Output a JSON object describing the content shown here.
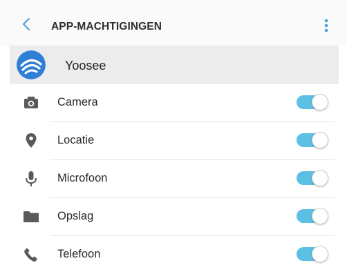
{
  "header": {
    "title": "APP-MACHTIGINGEN",
    "back_icon": "chevron-left-icon",
    "more_icon": "more-vertical-icon"
  },
  "app": {
    "name": "Yoosee",
    "icon": "yoosee-app-icon"
  },
  "permissions": [
    {
      "label": "Camera",
      "icon": "camera-icon",
      "enabled": true
    },
    {
      "label": "Locatie",
      "icon": "location-pin-icon",
      "enabled": true
    },
    {
      "label": "Microfoon",
      "icon": "microphone-icon",
      "enabled": true
    },
    {
      "label": "Opslag",
      "icon": "folder-icon",
      "enabled": true
    },
    {
      "label": "Telefoon",
      "icon": "phone-icon",
      "enabled": true
    }
  ],
  "colors": {
    "accent": "#4aa3d8",
    "toggle_on": "#5cbfe4",
    "icon_gray": "#5a5a5a",
    "app_row_bg": "#ececec"
  }
}
